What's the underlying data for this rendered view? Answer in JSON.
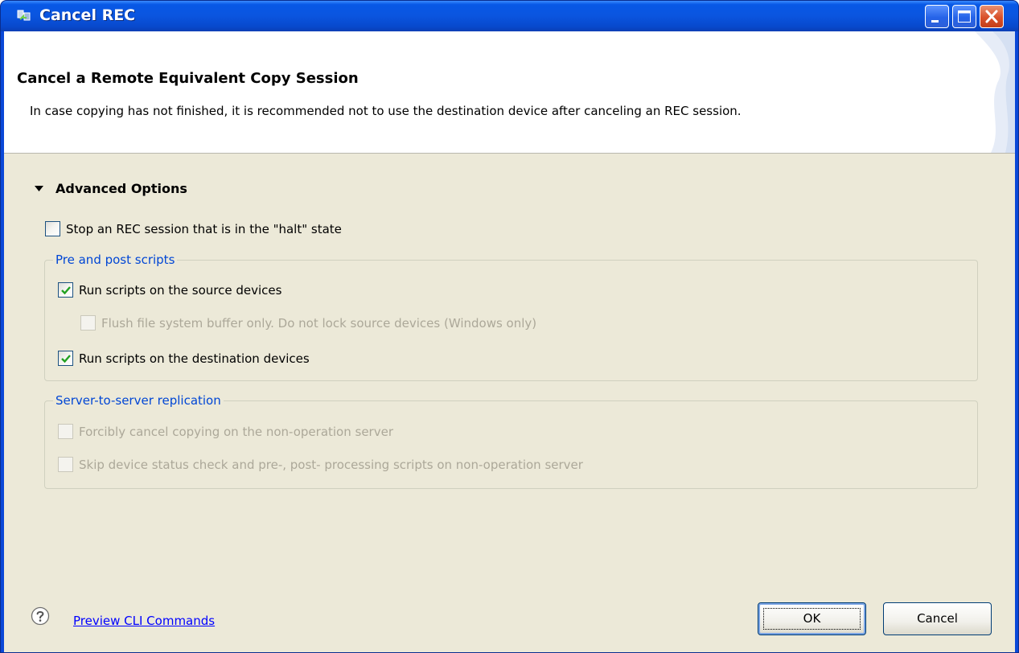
{
  "window": {
    "title": "Cancel REC",
    "controls": [
      "minimize",
      "maximize",
      "close"
    ],
    "icon": "app-icon"
  },
  "banner": {
    "title": "Cancel a Remote Equivalent Copy Session",
    "description": "In case copying has not finished, it is recommended not to use the destination device after canceling an REC session."
  },
  "advanced": {
    "label": "Advanced Options",
    "expanded": true,
    "stop_halt": {
      "label": "Stop an REC session that is in the \"halt\" state",
      "checked": false,
      "enabled": true
    }
  },
  "pre_post": {
    "legend": "Pre and post scripts",
    "run_source": {
      "label": "Run scripts on the source devices",
      "checked": true,
      "enabled": true
    },
    "flush_buffer": {
      "label": "Flush file system buffer only. Do not lock source devices (Windows only)",
      "checked": false,
      "enabled": false
    },
    "run_destination": {
      "label": "Run scripts on the destination devices",
      "checked": true,
      "enabled": true
    }
  },
  "replication": {
    "legend": "Server-to-server replication",
    "force_cancel": {
      "label": "Forcibly cancel copying on the non-operation server",
      "checked": false,
      "enabled": false
    },
    "skip_check": {
      "label": "Skip device status check and pre-, post- processing scripts on non-operation server",
      "checked": false,
      "enabled": false
    }
  },
  "footer": {
    "help_icon": "question-icon",
    "preview_link": "Preview CLI Commands",
    "ok_label": "OK",
    "cancel_label": "Cancel"
  },
  "colors": {
    "titlebar": "#0a55df",
    "dialog_bg": "#ece9d8",
    "group_legend": "#0046d5",
    "link": "#0000ff",
    "check_tick": "#21a121",
    "close_button": "#d9512b"
  }
}
